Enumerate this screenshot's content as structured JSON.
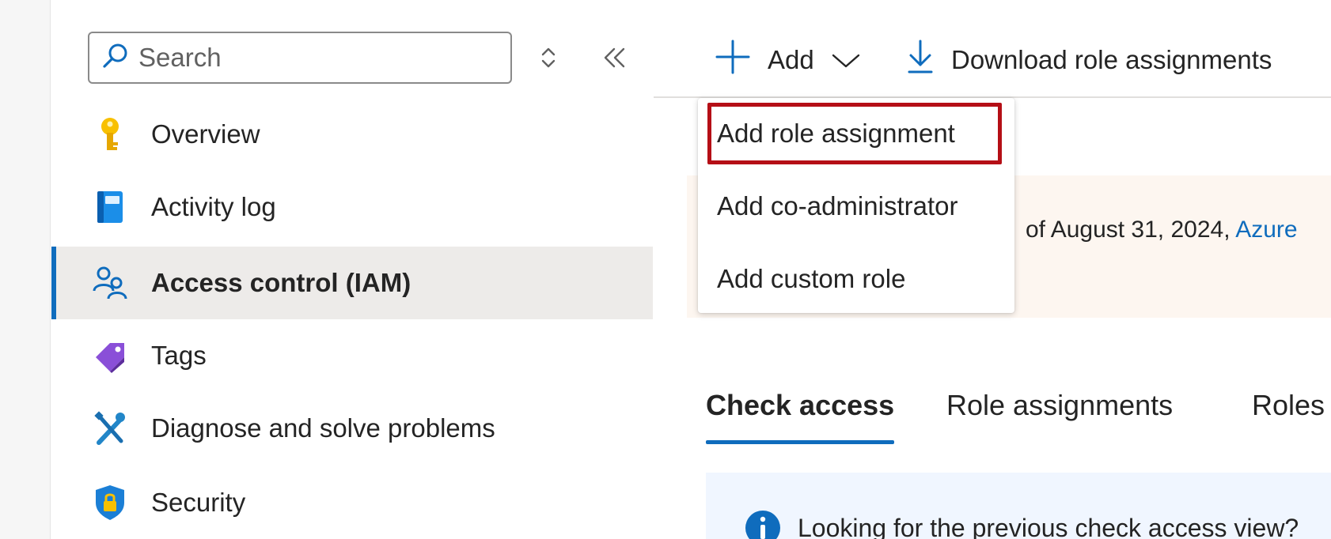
{
  "sidebar": {
    "search": {
      "placeholder": "Search",
      "value": ""
    },
    "items": [
      {
        "label": "Overview",
        "icon": "key-icon",
        "active": false
      },
      {
        "label": "Activity log",
        "icon": "activity-log-icon",
        "active": false
      },
      {
        "label": "Access control (IAM)",
        "icon": "people-icon",
        "active": true
      },
      {
        "label": "Tags",
        "icon": "tag-icon",
        "active": false
      },
      {
        "label": "Diagnose and solve problems",
        "icon": "wrench-screwdriver-icon",
        "active": false
      },
      {
        "label": "Security",
        "icon": "shield-lock-icon",
        "active": false
      }
    ]
  },
  "toolbar": {
    "add_label": "Add",
    "download_label": "Download role assignments"
  },
  "dropdown": {
    "items": [
      {
        "label": "Add role assignment",
        "highlighted": true
      },
      {
        "label": "Add co-administrator",
        "highlighted": false
      },
      {
        "label": "Add custom role",
        "highlighted": false
      }
    ]
  },
  "banner": {
    "text": "of August 31, 2024, ",
    "link": "Azure"
  },
  "tabs": [
    {
      "label": "Check access",
      "active": true
    },
    {
      "label": "Role assignments",
      "active": false
    },
    {
      "label": "Roles",
      "active": false
    }
  ],
  "info": {
    "text": "Looking for the previous check access view?"
  },
  "colors": {
    "accent": "#0f6cbd",
    "highlight_border": "#b50f16",
    "active_nav_bg": "#edebe9",
    "warning_bg": "#fdf6f0",
    "info_bg": "#f0f6ff"
  }
}
